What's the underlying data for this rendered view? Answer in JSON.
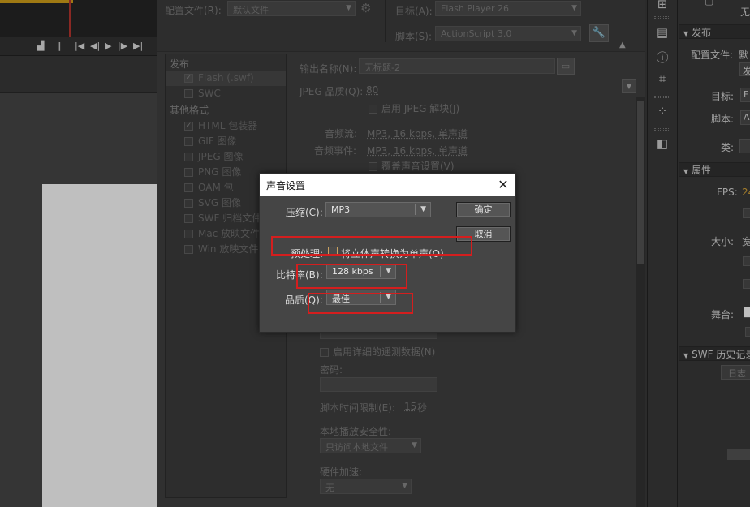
{
  "publish": {
    "profile_label": "配置文件(R):",
    "profile_value": "默认文件",
    "target_label": "目标(A):",
    "target_value": "Flash Player 26",
    "script_label": "脚本(S):",
    "script_value": "ActionScript 3.0",
    "formats": {
      "publish_header": "发布",
      "flash": "Flash (.swf)",
      "swc": "SWC",
      "other_header": "其他格式",
      "items": [
        "HTML 包装器",
        "GIF 图像",
        "JPEG 图像",
        "PNG 图像",
        "OAM 包",
        "SVG 图像",
        "SWF 归档文件",
        "Mac 放映文件",
        "Win 放映文件"
      ]
    },
    "output_label": "输出名称(N):",
    "output_value": "无标题-2",
    "jpeg_label": "JPEG 品质(Q):",
    "jpeg_value": "80",
    "jpeg_deblock": "启用 JPEG 解块(J)",
    "audio_stream_label": "音频流:",
    "audio_stream_value": "MP3, 16 kbps, 单声道",
    "audio_event_label": "音频事件:",
    "audio_event_value": "MP3, 16 kbps, 单声道",
    "override_sound": "覆盖声音设置(V)",
    "telemetry": "启用详细的遥测数据(N)",
    "password_label": "密码:",
    "script_time_label": "脚本时间限制(E):",
    "script_time_value": "15",
    "script_time_unit": "秒",
    "local_security_label": "本地播放安全性:",
    "local_security_value": "只访问本地文件",
    "hw_accel_label": "硬件加速:",
    "hw_accel_value": "无"
  },
  "sound_dialog": {
    "title": "声音设置",
    "compression_label": "压缩(C):",
    "compression_value": "MP3",
    "ok": "确定",
    "cancel": "取消",
    "preprocess_label": "预处理:",
    "preprocess_option": "将立体声转换为单声(O)",
    "bitrate_label": "比特率(B):",
    "bitrate_value": "128 kbps",
    "quality_label": "品质(Q):",
    "quality_value": "最佳"
  },
  "properties": {
    "top_label": "无",
    "publish_header": "发布",
    "profile_label": "配置文件:",
    "profile_value": "默",
    "target_label": "目标:",
    "target_value": "F",
    "script_label": "脚本:",
    "script_value": "A",
    "class_label": "类:",
    "attributes_header": "属性",
    "fps_label": "FPS:",
    "fps_value": "24",
    "size_label": "大小:",
    "size_value": "宽",
    "stage_label": "舞台:",
    "swf_history_header": "SWF 历史记录",
    "log_button": "日志"
  },
  "colors": {
    "highlight_red": "#d41e1e",
    "timeline_marker": "#d4a21a",
    "playhead": "#b8362f"
  }
}
